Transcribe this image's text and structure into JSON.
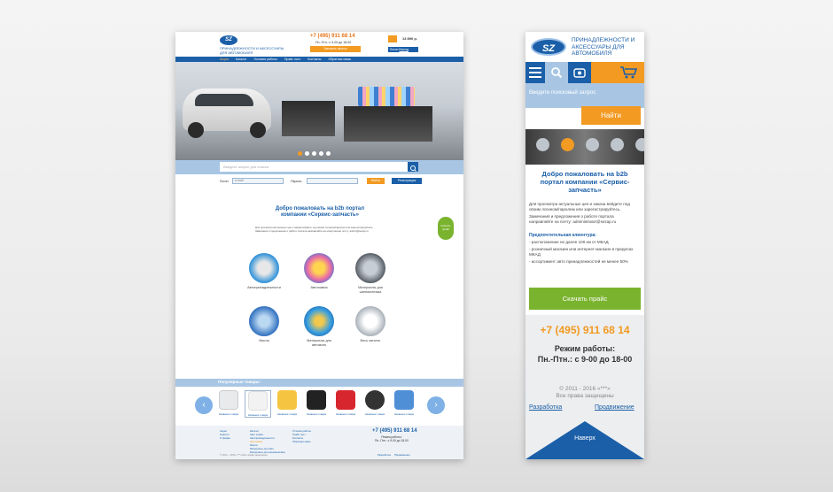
{
  "colors": {
    "brand_blue": "#1b5fa8",
    "orange": "#f29a22",
    "green": "#7ab32e",
    "light_blue": "#a8c6e4"
  },
  "desktop": {
    "logo": "SZ",
    "tagline": "ПРИНАДЛЕЖНОСТИ И АКСЕССУАРЫ ДЛЯ АВТОМОБИЛЯ",
    "phone": "+7 (495) 911 68 14",
    "hours": "Пн.-Птн.: с 9-00 до 18-00",
    "callback": "Заказать звонок",
    "cart_price": "13 890 р.",
    "login_label": "Логин",
    "logout_label": "Выход",
    "nav": [
      "Акции",
      "Каталог",
      "Условия работы",
      "Прайс лист",
      "Контакты",
      "Обратная связь"
    ],
    "search_placeholder": "Введите запрос для поиска",
    "login_field_label": "Логин:",
    "login_value": "e-mail",
    "password_label": "Пароль:",
    "enter_button": "Войти",
    "register_button": "Регистрация",
    "welcome": "Добро пожаловать на b2b портал компании «Сервис-запчасть»",
    "intro": "Для просмотра актуальных цен и заказа войдите под своим логином/паролем или зарегистрируйтесь. Замечания и предложения о работе портала направляйте на электронную почту: admin@sezap.ru",
    "download_side": "Скачать прайс",
    "categories": [
      "Автопринадлежности",
      "Автохимия",
      "Материалы для шиномонтажа",
      "Масла",
      "Материалы для автомоек",
      "Весь каталог"
    ],
    "popular_title": "Популярные товары:",
    "products": [
      "Название товара",
      "Название товара",
      "Название товара",
      "Название товара",
      "Название товара",
      "Название товара",
      "Название товара"
    ],
    "footer_cols": [
      [
        "Акции",
        "Новости",
        "О фирме"
      ],
      [
        "Каталог",
        "Авто химия",
        "Автопринадлежности",
        "Автохимия",
        "Масла",
        "Материалы для авто",
        "Материалы для шиномонтажа"
      ],
      [
        "Условия работы",
        "Прайс лист",
        "Контакты",
        "Обратная связь"
      ]
    ],
    "footer_phone": "+7 (495) 911 68 14",
    "footer_hours_title": "Режим работы:",
    "footer_hours": "Пн.-Птн.: с 9-00 до 18-00",
    "copyright": "© 2011 - 2016 «***» Все права защищены",
    "dev_link": "Разработка",
    "promo_link": "Продвижение"
  },
  "mobile": {
    "logo": "SZ",
    "tagline": "ПРИНАДЛЕЖНОСТИ И АКСЕССУАРЫ ДЛЯ АВТОМОБИЛЯ",
    "search_placeholder": "Введите поисковый запрос",
    "find_button": "Найти",
    "welcome": "Добро пожаловать на b2b портал компании «Сервис-запчасть»",
    "intro1": "Для просмотра актуальных цен и заказа войдите под своим логином/паролем или зарегистрируйтесь.",
    "intro2": "Замечания и предложения о работе портала направляйте на почту: administrator@sezap.ru",
    "benefits_title": "Предпочтительная клиентура:",
    "benefits": [
      "- расположение не далее 100 км от МКАД",
      "- розничный магазин или интернет-магазин в пределах МКАД",
      "- ассортимент авто принадлежностей не менее 50%"
    ],
    "download_button": "Скачать прайс",
    "phone": "+7 (495) 911 68 14",
    "hours_title": "Режим работы:",
    "hours": "Пн.-Птн.: с 9-00 до 18-00",
    "copyright_line1": "© 2011 - 2016 «***»",
    "copyright_line2": "Все права защищены",
    "dev_link": "Разработка",
    "promo_link": "Продвижение",
    "up_button": "Наверх"
  }
}
